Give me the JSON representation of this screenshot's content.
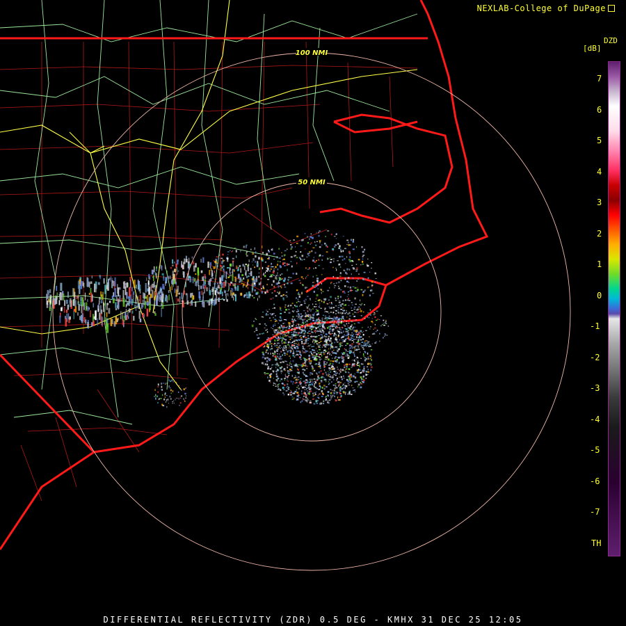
{
  "credit": "NEXLAB-College of DuPage",
  "credit_icon": "external-link-icon",
  "footer": "DIFFERENTIAL REFLECTIVITY (ZDR) 0.5 DEG - KMHX 31 DEC 25 12:05",
  "range_rings": [
    {
      "label": "50 NMI",
      "nmi": 50
    },
    {
      "label": "100 NMI",
      "nmi": 100
    }
  ],
  "legend": {
    "product": "DZD",
    "unit": "[dB]",
    "labels": [
      "7",
      "6",
      "5",
      "4",
      "3",
      "2",
      "1",
      "0",
      "-1",
      "-2",
      "-3",
      "-4",
      "-5",
      "-6",
      "-7",
      "TH"
    ]
  },
  "colors": {
    "background": "#000000",
    "state_borders": "#ff1a1a",
    "county_lines": "#b01818",
    "highways": "#9be89b",
    "interstates": "#ffff44",
    "range_rings": "#f0b8a8",
    "text": "#ffff33"
  }
}
